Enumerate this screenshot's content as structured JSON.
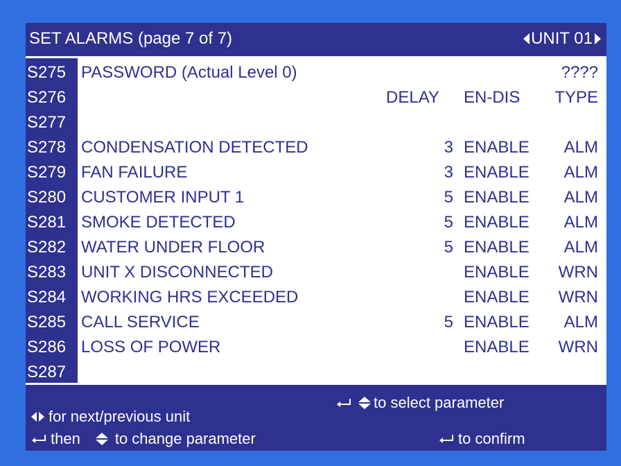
{
  "header": {
    "title": "SET ALARMS (page  7 of 7)",
    "unit_label": "UNIT 01"
  },
  "columns": {
    "delay": "DELAY",
    "endis": "EN-DIS",
    "type": "TYPE"
  },
  "rows": [
    {
      "code": "S275",
      "desc": "PASSWORD   (Actual Level  0)",
      "delay": "",
      "endis": "",
      "type": "",
      "value": "????"
    },
    {
      "code": "S276",
      "desc": "",
      "delay": "",
      "endis": "",
      "type": "",
      "value": ""
    },
    {
      "code": "S277",
      "desc": "",
      "delay": "",
      "endis": "",
      "type": "",
      "value": ""
    },
    {
      "code": "S278",
      "desc": "CONDENSATION DETECTED",
      "delay": "3",
      "endis": "ENABLE",
      "type": "ALM",
      "value": ""
    },
    {
      "code": "S279",
      "desc": "FAN FAILURE",
      "delay": "3",
      "endis": "ENABLE",
      "type": "ALM",
      "value": ""
    },
    {
      "code": "S280",
      "desc": "CUSTOMER INPUT 1",
      "delay": "5",
      "endis": "ENABLE",
      "type": "ALM",
      "value": ""
    },
    {
      "code": "S281",
      "desc": "SMOKE DETECTED",
      "delay": "5",
      "endis": "ENABLE",
      "type": "ALM",
      "value": ""
    },
    {
      "code": "S282",
      "desc": "WATER UNDER FLOOR",
      "delay": "5",
      "endis": "ENABLE",
      "type": "ALM",
      "value": ""
    },
    {
      "code": "S283",
      "desc": "UNIT X DISCONNECTED",
      "delay": "",
      "endis": "ENABLE",
      "type": "WRN",
      "value": ""
    },
    {
      "code": "S284",
      "desc": "WORKING HRS EXCEEDED",
      "delay": "",
      "endis": "ENABLE",
      "type": "WRN",
      "value": ""
    },
    {
      "code": "S285",
      "desc": "CALL SERVICE",
      "delay": "5",
      "endis": "ENABLE",
      "type": "ALM",
      "value": ""
    },
    {
      "code": "S286",
      "desc": "LOSS OF POWER",
      "delay": "",
      "endis": "ENABLE",
      "type": "WRN",
      "value": ""
    },
    {
      "code": "S287",
      "desc": "",
      "delay": "",
      "endis": "",
      "type": "",
      "value": ""
    }
  ],
  "help": {
    "next_prev": "for next/previous unit",
    "select": "to select parameter",
    "then": "then",
    "change": "to change parameter",
    "confirm": "to confirm"
  },
  "colors": {
    "background": "#2f6fe0",
    "panel": "#2e3190",
    "text_dark": "#2e3190",
    "text_light": "#ffffff"
  },
  "icons": [
    "left-right-arrows-icon",
    "up-down-arrows-icon",
    "enter-icon"
  ]
}
